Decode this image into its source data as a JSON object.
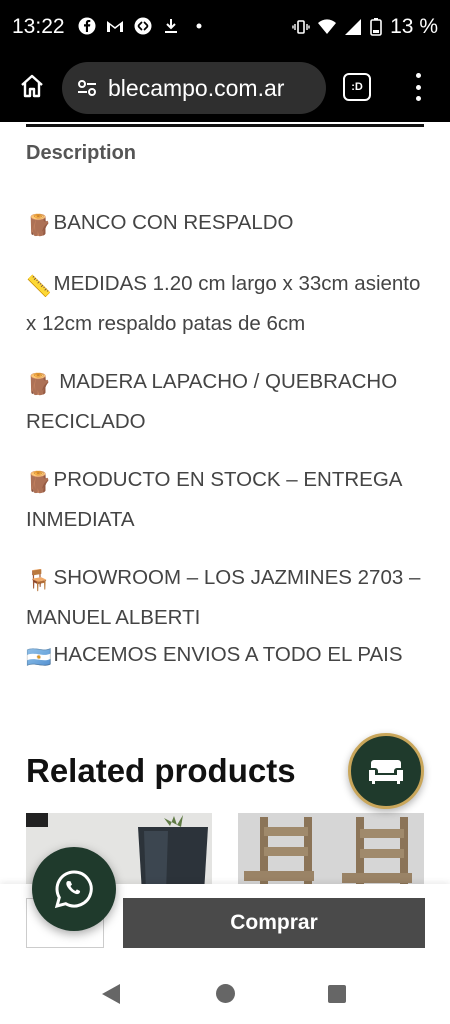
{
  "status_bar": {
    "time": "13:22",
    "battery": "13 %",
    "left_icons": [
      "facebook-icon",
      "gmail-icon",
      "shazam-icon",
      "download-icon",
      "dot-icon"
    ],
    "right_icons": [
      "vibrate-icon",
      "wifi-icon",
      "signal-icon",
      "battery-icon"
    ]
  },
  "browser": {
    "url": "blecampo.com.ar",
    "tab_label": ":D"
  },
  "description": {
    "heading": "Description",
    "items": [
      {
        "emoji": "🪵",
        "text": "BANCO CON RESPALDO"
      },
      {
        "emoji": "📏",
        "text": "MEDIDAS 1.20 cm largo x 33cm asiento x 12cm respaldo  patas de 6cm"
      },
      {
        "emoji": "🪵",
        "text": " MADERA LAPACHO / QUEBRACHO RECICLADO"
      },
      {
        "emoji": "🪵",
        "text": "PRODUCTO EN STOCK – ENTREGA INMEDIATA"
      },
      {
        "emoji": "🪑",
        "text": "SHOWROOM – LOS JAZMINES 2703 – MANUEL ALBERTI"
      },
      {
        "emoji": "🇦🇷",
        "text": "HACEMOS ENVIOS A TODO EL PAIS"
      }
    ]
  },
  "related": {
    "title": "Related products"
  },
  "buy": {
    "button_label": "Comprar"
  },
  "colors": {
    "brand_green": "#1f3a2c",
    "gold_ring": "#c9a65a",
    "buy_button": "#4a4a4a"
  }
}
